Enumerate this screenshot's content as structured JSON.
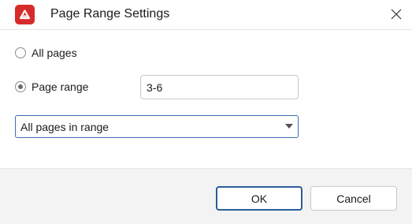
{
  "window": {
    "title": "Page Range Settings",
    "app_icon": "pdf-app-icon",
    "close_icon": "close-icon"
  },
  "options": {
    "all_pages_label": "All pages",
    "all_pages_selected": false,
    "page_range_label": "Page range",
    "page_range_selected": true,
    "page_range_value": "3-6"
  },
  "subset": {
    "selected": "All pages in range"
  },
  "buttons": {
    "ok_label": "OK",
    "cancel_label": "Cancel"
  },
  "colors": {
    "app_icon_bg": "#d62b2b",
    "focus_border": "#3a6fb0",
    "footer_bg": "#f3f3f3"
  }
}
